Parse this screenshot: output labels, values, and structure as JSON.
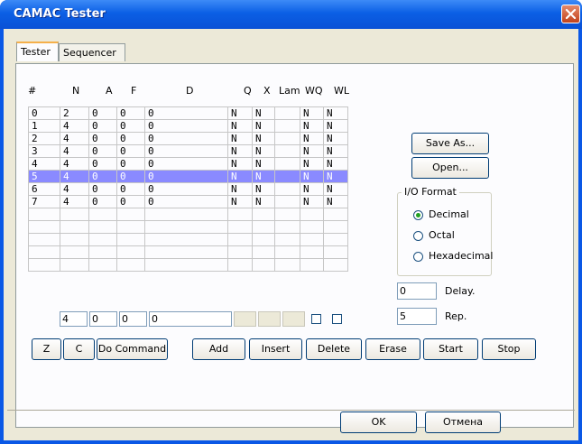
{
  "window": {
    "title": "CAMAC Tester"
  },
  "tabs": [
    {
      "label": "Tester"
    },
    {
      "label": "Sequencer"
    }
  ],
  "grid": {
    "columns": [
      "#",
      "N",
      "A",
      "F",
      "D",
      "Q",
      "X",
      "Lam",
      "WQ",
      "WL"
    ],
    "rows": [
      {
        "idx": "0",
        "n": "2",
        "a": "0",
        "f": "0",
        "d": "0",
        "q": "N",
        "x": "N",
        "lam": "",
        "wq": "N",
        "wl": "N"
      },
      {
        "idx": "1",
        "n": "4",
        "a": "0",
        "f": "0",
        "d": "0",
        "q": "N",
        "x": "N",
        "lam": "",
        "wq": "N",
        "wl": "N"
      },
      {
        "idx": "2",
        "n": "4",
        "a": "0",
        "f": "0",
        "d": "0",
        "q": "N",
        "x": "N",
        "lam": "",
        "wq": "N",
        "wl": "N"
      },
      {
        "idx": "3",
        "n": "4",
        "a": "0",
        "f": "0",
        "d": "0",
        "q": "N",
        "x": "N",
        "lam": "",
        "wq": "N",
        "wl": "N"
      },
      {
        "idx": "4",
        "n": "4",
        "a": "0",
        "f": "0",
        "d": "0",
        "q": "N",
        "x": "N",
        "lam": "",
        "wq": "N",
        "wl": "N"
      },
      {
        "idx": "5",
        "n": "4",
        "a": "0",
        "f": "0",
        "d": "0",
        "q": "N",
        "x": "N",
        "lam": "",
        "wq": "N",
        "wl": "N",
        "selected": true
      },
      {
        "idx": "6",
        "n": "4",
        "a": "0",
        "f": "0",
        "d": "0",
        "q": "N",
        "x": "N",
        "lam": "",
        "wq": "N",
        "wl": "N"
      },
      {
        "idx": "7",
        "n": "4",
        "a": "0",
        "f": "0",
        "d": "0",
        "q": "N",
        "x": "N",
        "lam": "",
        "wq": "N",
        "wl": "N"
      }
    ],
    "empty_rows": 5,
    "selected_color": "#8a8aff"
  },
  "side": {
    "save_as": "Save As...",
    "open": "Open..."
  },
  "io_format": {
    "label": "I/O Format",
    "options": [
      {
        "label": "Decimal",
        "selected": true
      },
      {
        "label": "Octal",
        "selected": false
      },
      {
        "label": "Hexadecimal",
        "selected": false
      }
    ]
  },
  "delay": {
    "value": "0",
    "label": "Delay."
  },
  "rep": {
    "value": "5",
    "label": "Rep."
  },
  "inputs": {
    "n": "4",
    "a": "0",
    "f": "0",
    "d": "0"
  },
  "buttons": {
    "z": "Z",
    "c": "C",
    "do_command": "Do Command",
    "add": "Add",
    "insert": "Insert",
    "delete": "Delete",
    "erase": "Erase",
    "start": "Start",
    "stop": "Stop"
  },
  "footer": {
    "ok": "OK",
    "cancel": "Отмена"
  },
  "colors": {
    "titlebar": "#0a58e6",
    "face": "#ece9d8",
    "close": "#c2421c"
  }
}
